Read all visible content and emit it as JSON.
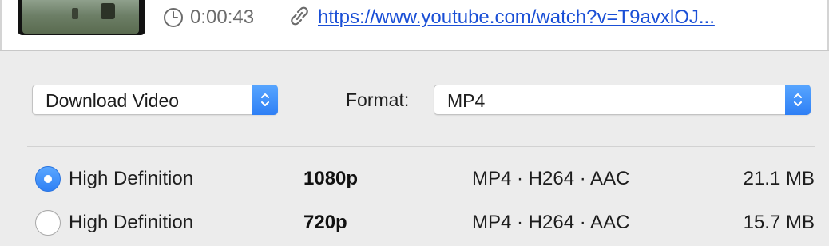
{
  "video": {
    "duration": "0:00:43",
    "url": "https://www.youtube.com/watch?v=T9avxlOJ..."
  },
  "controls": {
    "action": "Download Video",
    "format_label": "Format:",
    "format_value": "MP4"
  },
  "qualities": [
    {
      "label": "High Definition",
      "resolution": "1080p",
      "codecs": "MP4 · H264 · AAC",
      "size": "21.1 MB",
      "selected": true
    },
    {
      "label": "High Definition",
      "resolution": "720p",
      "codecs": "MP4 · H264 · AAC",
      "size": "15.7 MB",
      "selected": false
    }
  ],
  "colors": {
    "accent": "#2f80f5",
    "link": "#1a4fd6",
    "muted_text": "#6b6b6b",
    "background": "#ececec"
  },
  "icons": {
    "duration": "clock-icon",
    "url": "link-icon",
    "popup": "up-down-chevron-icon"
  }
}
